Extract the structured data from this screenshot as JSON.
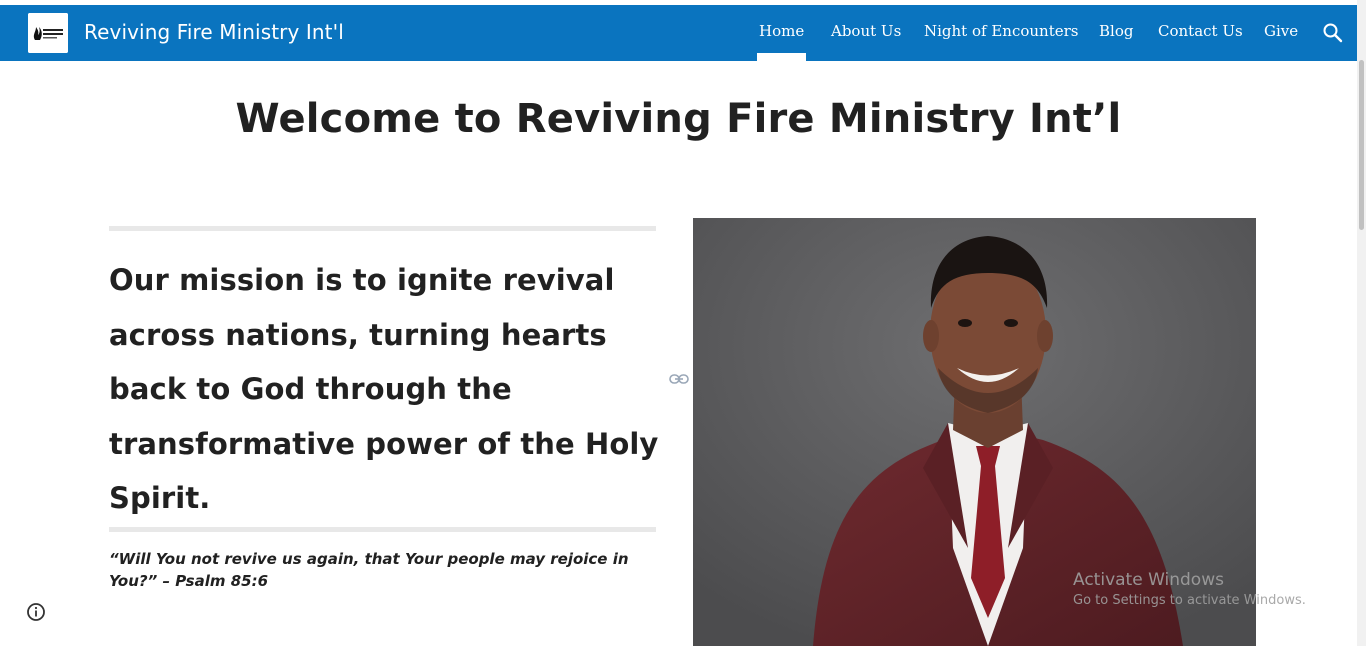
{
  "header": {
    "logo_icon": "flame-logo-icon",
    "site_title": "Reviving Fire Ministry Int'l",
    "background": "#0a74bf"
  },
  "nav": {
    "items": [
      {
        "label": "Home",
        "active": true
      },
      {
        "label": "About Us",
        "active": false
      },
      {
        "label": "Night of Encounters",
        "active": false
      },
      {
        "label": "Blog",
        "active": false
      },
      {
        "label": "Contact Us",
        "active": false
      },
      {
        "label": "Give",
        "active": false
      }
    ],
    "search_icon": "search-icon"
  },
  "main": {
    "page_title": "Welcome to Reviving Fire Ministry Int’l",
    "mission": "Our mission is to ignite revival across nations, turning hearts back to God through the transformative power of the Holy Spirit.",
    "quote_text": "“Will You not revive us again, that Your people may rejoice in You?”",
    "quote_reference": " – Psalm 85:6",
    "link_icon": "link-icon",
    "photo_icon": "portrait-photo"
  },
  "footer": {
    "info_icon": "info-icon"
  },
  "overlay": {
    "activate_title": "Activate Windows",
    "activate_sub": "Go to Settings to activate Windows."
  }
}
